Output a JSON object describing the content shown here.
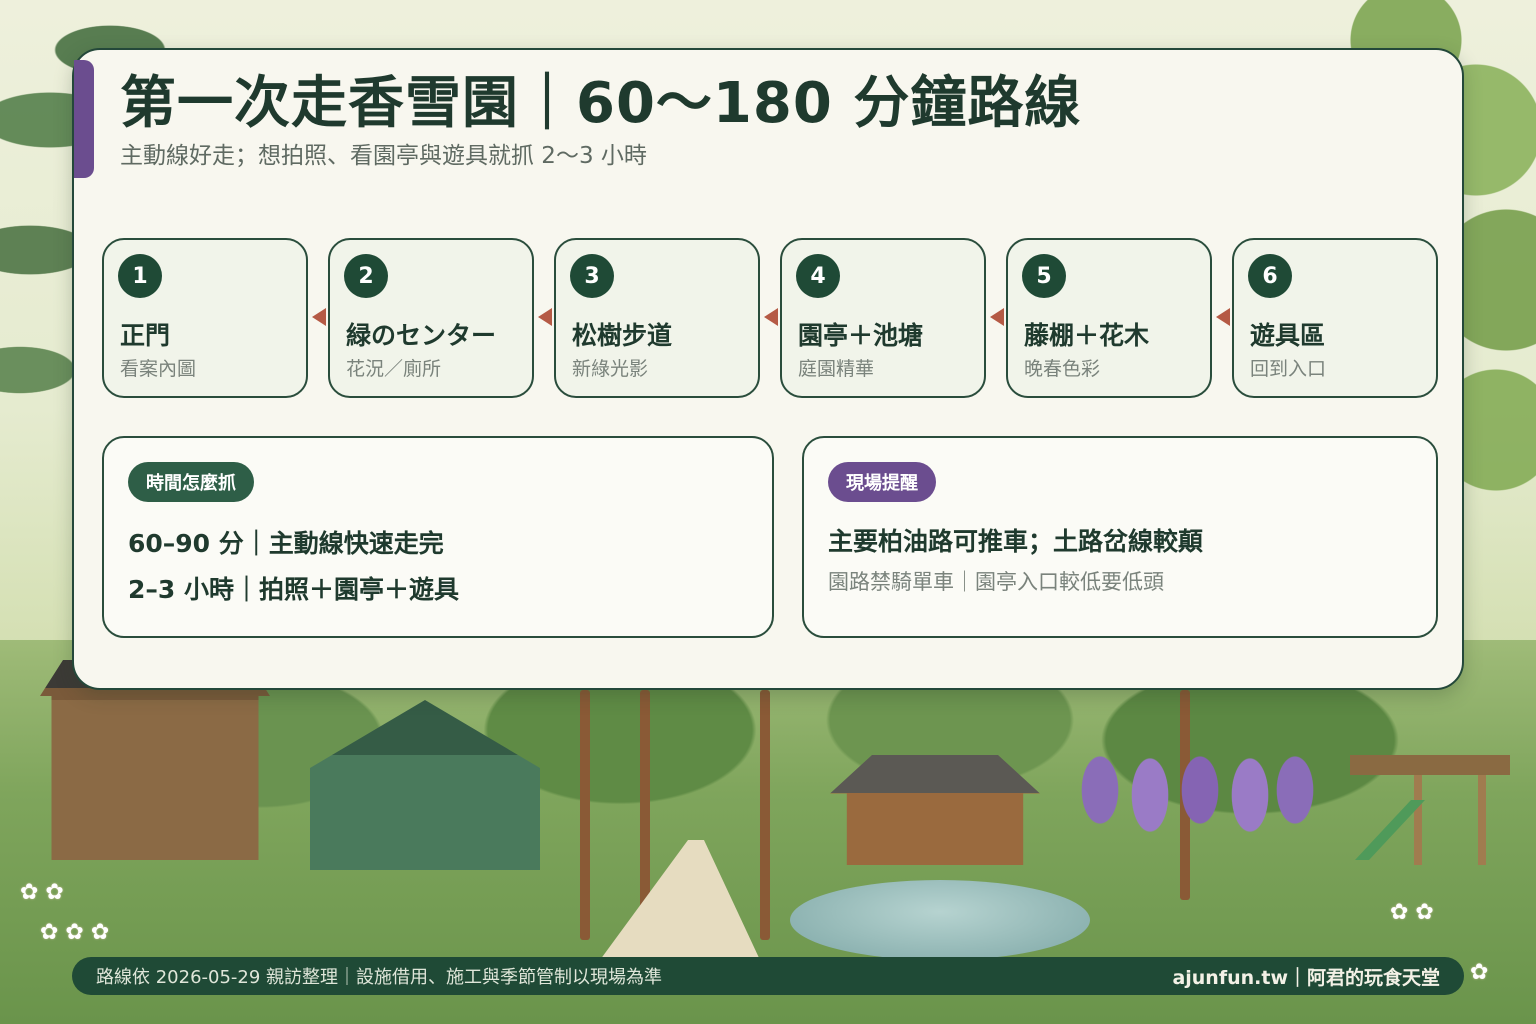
{
  "header": {
    "title": "第一次走香雪園｜60～180 分鐘路線",
    "subtitle": "主動線好走；想拍照、看園亭與遊具就抓 2～3 小時"
  },
  "steps": [
    {
      "num": "1",
      "title": "正門",
      "sub": "看案內圖"
    },
    {
      "num": "2",
      "title": "緑のセンター",
      "sub": "花況／廁所"
    },
    {
      "num": "3",
      "title": "松樹步道",
      "sub": "新綠光影"
    },
    {
      "num": "4",
      "title": "園亭＋池塘",
      "sub": "庭園精華"
    },
    {
      "num": "5",
      "title": "藤棚＋花木",
      "sub": "晚春色彩"
    },
    {
      "num": "6",
      "title": "遊具區",
      "sub": "回到入口"
    }
  ],
  "time_box": {
    "badge": "時間怎麼抓",
    "lines": [
      "60–90 分｜主動線快速走完",
      "2–3 小時｜拍照＋園亭＋遊具"
    ]
  },
  "notice_box": {
    "badge": "現場提醒",
    "main": "主要柏油路可推車；土路岔線較顛",
    "note": "園路禁騎單車｜園亭入口較低要低頭"
  },
  "footer": {
    "note": "路線依 2026-05-29 親訪整理｜設施借用、施工與季節管制以現場為準",
    "brand": "ajunfun.tw｜阿君的玩食天堂"
  },
  "colors": {
    "primary_green": "#1f4a36",
    "accent_purple": "#6b4d8f",
    "arrow_red": "#b55a45",
    "card_bg": "#f8f7ef"
  }
}
